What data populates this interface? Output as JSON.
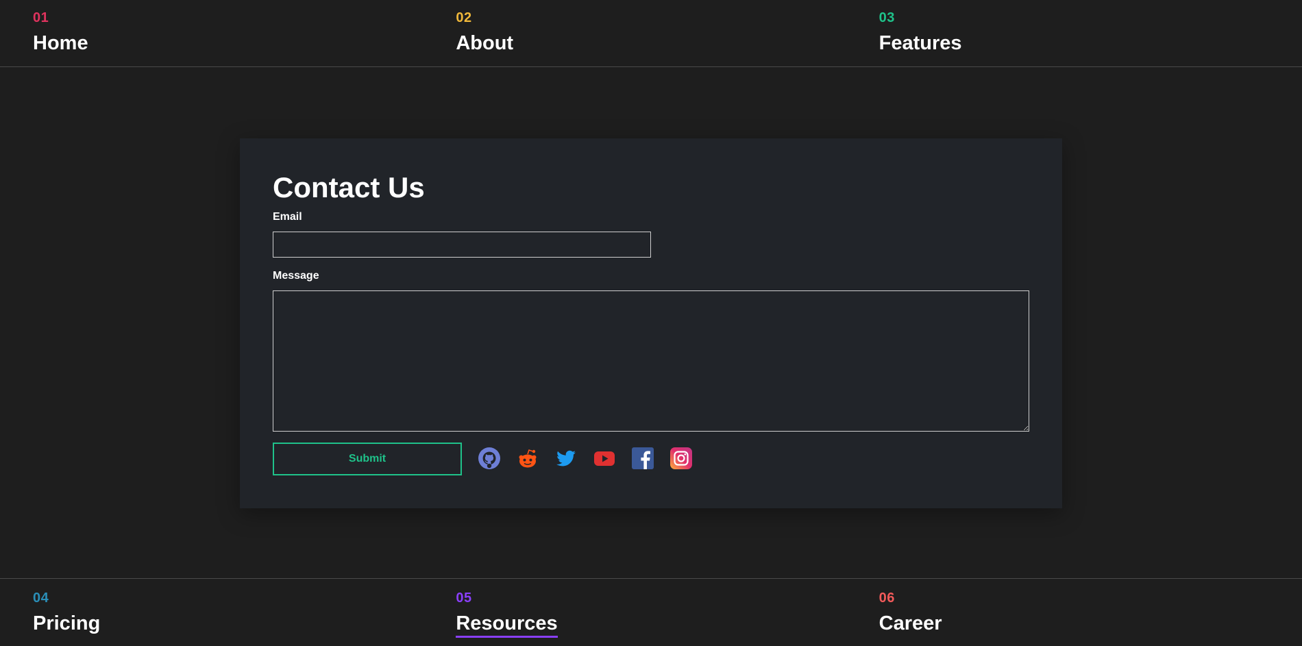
{
  "nav_top": [
    {
      "number": "01",
      "label": "Home",
      "color": "#e0335e"
    },
    {
      "number": "02",
      "label": "About",
      "color": "#f0b83a"
    },
    {
      "number": "03",
      "label": "Features",
      "color": "#1fc28a"
    }
  ],
  "nav_bottom": [
    {
      "number": "04",
      "label": "Pricing",
      "color": "#2a8fb8"
    },
    {
      "number": "05",
      "label": "Resources",
      "color": "#8a3ffc",
      "active": true
    },
    {
      "number": "06",
      "label": "Career",
      "color": "#f25a5a"
    }
  ],
  "contact": {
    "title": "Contact Us",
    "email_label": "Email",
    "email_value": "",
    "message_label": "Message",
    "message_value": "",
    "submit_label": "Submit"
  },
  "social_icons": [
    {
      "name": "github-icon",
      "color": "#6e7fd6"
    },
    {
      "name": "reddit-icon",
      "color": "#ff5414"
    },
    {
      "name": "twitter-icon",
      "color": "#1d9bf0"
    },
    {
      "name": "youtube-icon",
      "color": "#e03131"
    },
    {
      "name": "facebook-icon",
      "color": "#3b5998"
    },
    {
      "name": "instagram-icon",
      "color": "#e1306c"
    }
  ],
  "colors": {
    "background": "#1e1e1e",
    "card": "#212429",
    "accent_submit": "#1fc28a",
    "active_underline": "#8a3ffc"
  }
}
